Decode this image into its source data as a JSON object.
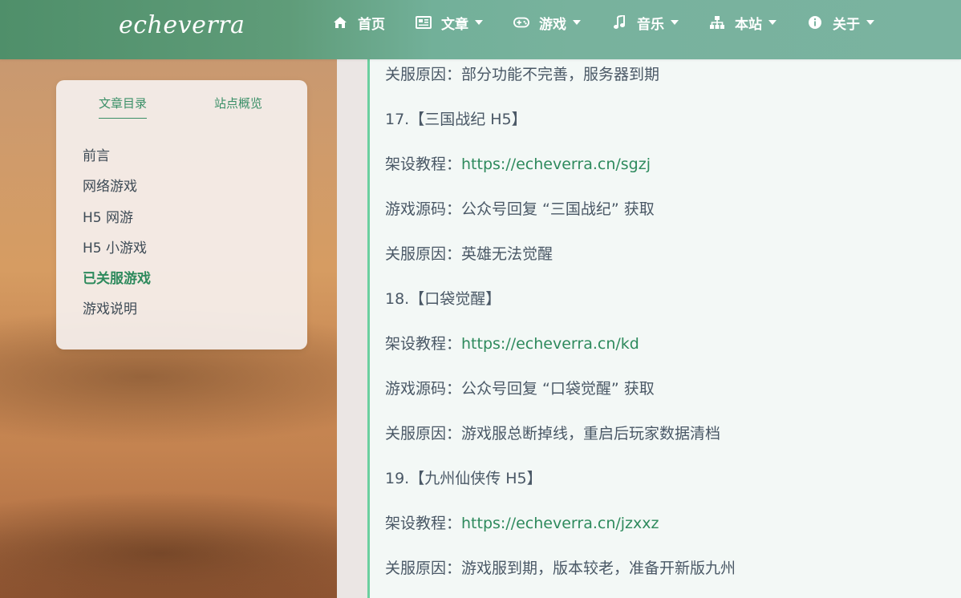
{
  "site": {
    "logo": "echeverra"
  },
  "nav": {
    "items": [
      {
        "label": "首页",
        "icon": "home-icon",
        "has_dropdown": false
      },
      {
        "label": "文章",
        "icon": "newspaper-icon",
        "has_dropdown": true
      },
      {
        "label": "游戏",
        "icon": "gamepad-icon",
        "has_dropdown": true
      },
      {
        "label": "音乐",
        "icon": "music-icon",
        "has_dropdown": true
      },
      {
        "label": "本站",
        "icon": "sitemap-icon",
        "has_dropdown": true
      },
      {
        "label": "关于",
        "icon": "info-icon",
        "has_dropdown": true
      }
    ]
  },
  "sidebar": {
    "tabs": [
      {
        "label": "文章目录",
        "active": true
      },
      {
        "label": "站点概览",
        "active": false
      }
    ],
    "toc": [
      {
        "label": "前言",
        "active": false
      },
      {
        "label": "网络游戏",
        "active": false
      },
      {
        "label": "H5 网游",
        "active": false
      },
      {
        "label": "H5 小游戏",
        "active": false
      },
      {
        "label": "已关服游戏",
        "active": true
      },
      {
        "label": "游戏说明",
        "active": false
      }
    ]
  },
  "article": {
    "l0": {
      "prefix": "关服原因：",
      "text": "部分功能不完善，服务器到期"
    },
    "l1": {
      "text": "17.【三国战纪 H5】"
    },
    "l2": {
      "prefix": "架设教程：",
      "link": "https://echeverra.cn/sgzj"
    },
    "l3": {
      "prefix": "游戏源码：",
      "text": "公众号回复 “三国战纪” 获取"
    },
    "l4": {
      "prefix": "关服原因：",
      "text": "英雄无法觉醒"
    },
    "l5": {
      "text": "18.【口袋觉醒】"
    },
    "l6": {
      "prefix": "架设教程：",
      "link": "https://echeverra.cn/kd"
    },
    "l7": {
      "prefix": "游戏源码：",
      "text": "公众号回复 “口袋觉醒” 获取"
    },
    "l8": {
      "prefix": "关服原因：",
      "text": "游戏服总断掉线，重启后玩家数据清档"
    },
    "l9": {
      "text": "19.【九州仙侠传 H5】"
    },
    "l10": {
      "prefix": "架设教程：",
      "link": "https://echeverra.cn/jzxxz"
    },
    "l11": {
      "prefix": "关服原因：",
      "text": "游戏服到期，版本较老，准备开新版九州"
    }
  },
  "colors": {
    "accent": "#2e8a5d",
    "nav": "#7ab3a0",
    "border": "#6bcf9f"
  }
}
